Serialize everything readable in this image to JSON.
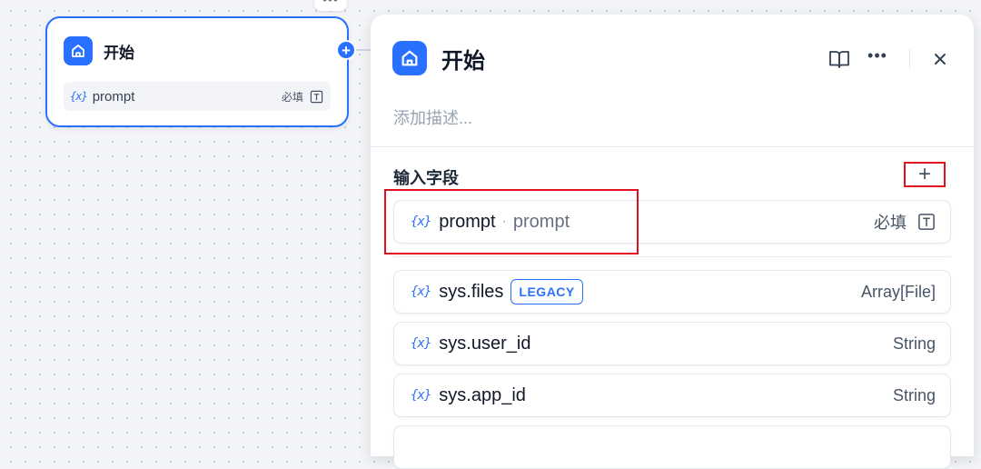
{
  "node": {
    "title": "开始",
    "variable": {
      "symbol": "{x}",
      "name": "prompt",
      "required_label": "必填"
    }
  },
  "panel": {
    "title": "开始",
    "description_placeholder": "添加描述...",
    "section_title": "输入字段",
    "add_label": "+",
    "fields": [
      {
        "symbol": "{x}",
        "name": "prompt",
        "label": "prompt",
        "required_label": "必填"
      },
      {
        "symbol": "{x}",
        "name": "sys.files",
        "badge": "LEGACY",
        "type": "Array[File]"
      },
      {
        "symbol": "{x}",
        "name": "sys.user_id",
        "type": "String"
      },
      {
        "symbol": "{x}",
        "name": "sys.app_id",
        "type": "String"
      }
    ]
  },
  "icons": {
    "node": "home-icon",
    "help": "book-icon",
    "more": "more-icon",
    "close": "close-icon",
    "text_input": "text-input-icon"
  },
  "colors": {
    "accent": "#2970ff",
    "highlight": "#e0101e"
  }
}
